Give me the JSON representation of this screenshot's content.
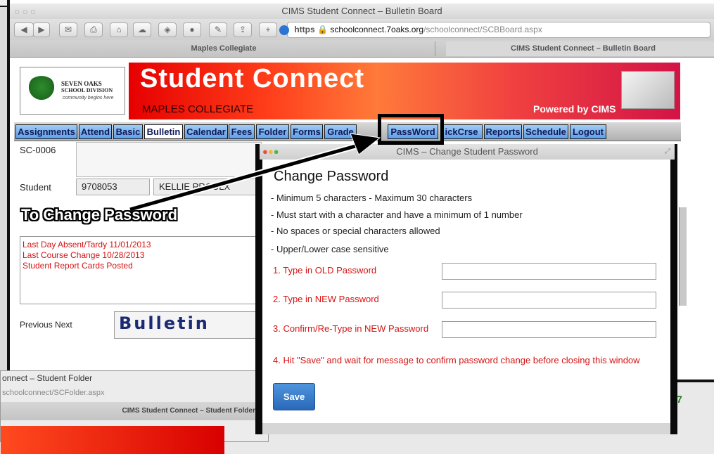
{
  "browser": {
    "window_title": "CIMS Student Connect – Bulletin Board",
    "url_scheme": "https",
    "url_host": "schoolconnect.7oaks.org",
    "url_path": "/schoolconnect/SCBBoard.aspx",
    "tabs": [
      {
        "label": "Maples Collegiate"
      },
      {
        "label": "CIMS Student Connect – Bulletin Board"
      }
    ]
  },
  "site": {
    "logo_line1": "SEVEN OAKS",
    "logo_line2": "SCHOOL DIVISION",
    "logo_line3": "community begins here",
    "banner_title": "Student Connect",
    "school": "MAPLES COLLEGIATE",
    "powered_by": "Powered by CIMS"
  },
  "nav": [
    {
      "label": "Assignments"
    },
    {
      "label": "Attend"
    },
    {
      "label": "Basic"
    },
    {
      "label": "Bulletin"
    },
    {
      "label": "Calendar"
    },
    {
      "label": "Fees"
    },
    {
      "label": "Folder"
    },
    {
      "label": "Forms"
    },
    {
      "label": "Grade"
    },
    {
      "label": "PassWord"
    },
    {
      "label": "ickCrse"
    },
    {
      "label": "Reports"
    },
    {
      "label": "Schedule"
    },
    {
      "label": "Logout"
    }
  ],
  "page": {
    "code": "SC-0006",
    "student_label": "Student",
    "student_id": "9708053",
    "student_name": "KELLIE PROULX",
    "bulletin_items": [
      "Last Day Absent/Tardy 11/01/2013",
      "Last Course Change 10/28/2013",
      "Student Report Cards Posted"
    ],
    "pager": "Previous Next",
    "bulletin_heading": "Bulletin"
  },
  "annotation": {
    "callout": "To Change Password"
  },
  "dialog": {
    "title": "CIMS – Change Student Password",
    "heading": "Change Password",
    "rules": [
      "- Minimum 5 characters - Maximum 30 characters",
      "- Must start with a character and have a minimum of 1 number",
      "- No spaces or special characters allowed",
      "- Upper/Lower case sensitive"
    ],
    "step1": "1. Type in OLD Password",
    "step2": "2. Type in NEW Password",
    "step3": "3. Confirm/Re-Type in NEW Password",
    "step4": "4. Hit \"Save\" and wait for message to confirm password change before closing this window",
    "save_label": "Save"
  },
  "bg_window": {
    "title": "onnect – Student Folder",
    "url": "schoolconnect/SCFolder.aspx",
    "tab": "CIMS Student Connect – Student Folder"
  },
  "colors": {
    "accent_red": "#d41414",
    "nav_blue": "#5e9fe6",
    "save_blue": "#2868b9"
  }
}
